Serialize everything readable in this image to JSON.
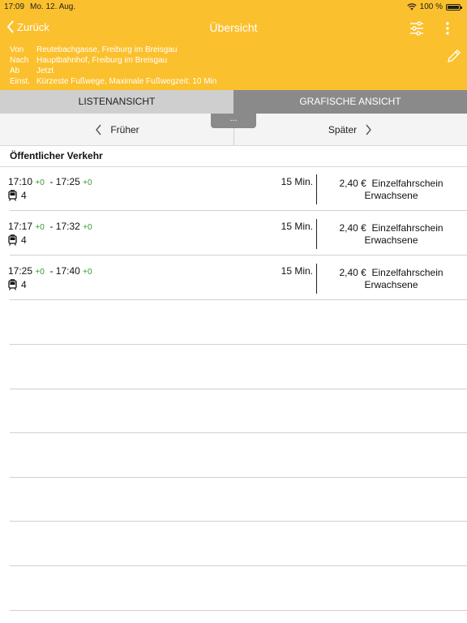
{
  "statusbar": {
    "time": "17:09",
    "date": "Mo. 12. Aug.",
    "battery": "100 %"
  },
  "nav": {
    "back_label": "Zurück",
    "title": "Übersicht"
  },
  "summary": {
    "from_label": "Von",
    "from": "Reutebachgasse, Freiburg im Breisgau",
    "to_label": "Nach",
    "to": "Hauptbahnhof, Freiburg im Breisgau",
    "dep_label": "Ab",
    "dep": "Jetzt",
    "settings_label": "Einst.",
    "settings": "Kürzeste Fußwege, Maximale Fußwegzeit: 10 Min"
  },
  "tabs": [
    {
      "label": "LISTENANSICHT",
      "active": true
    },
    {
      "label": "GRAFISCHE ANSICHT",
      "active": false
    }
  ],
  "pager": {
    "earlier": "Früher",
    "later": "Später",
    "handle": "..."
  },
  "section_title": "Öffentlicher Verkehr",
  "connections": [
    {
      "dep": "17:10",
      "dep_delay": "+0",
      "arr": "17:25",
      "arr_delay": "+0",
      "line": "4",
      "duration": "15 Min.",
      "price": "2,40 €",
      "fare_name": "Einzelfahrschein",
      "fare_type": "Erwachsene"
    },
    {
      "dep": "17:17",
      "dep_delay": "+0",
      "arr": "17:32",
      "arr_delay": "+0",
      "line": "4",
      "duration": "15 Min.",
      "price": "2,40 €",
      "fare_name": "Einzelfahrschein",
      "fare_type": "Erwachsene"
    },
    {
      "dep": "17:25",
      "dep_delay": "+0",
      "arr": "17:40",
      "arr_delay": "+0",
      "line": "4",
      "duration": "15 Min.",
      "price": "2,40 €",
      "fare_name": "Einzelfahrschein",
      "fare_type": "Erwachsene"
    }
  ],
  "colors": {
    "header": "#fbc02d",
    "delay": "#2e9d2e",
    "tab_bar": "#8a8a8a"
  }
}
